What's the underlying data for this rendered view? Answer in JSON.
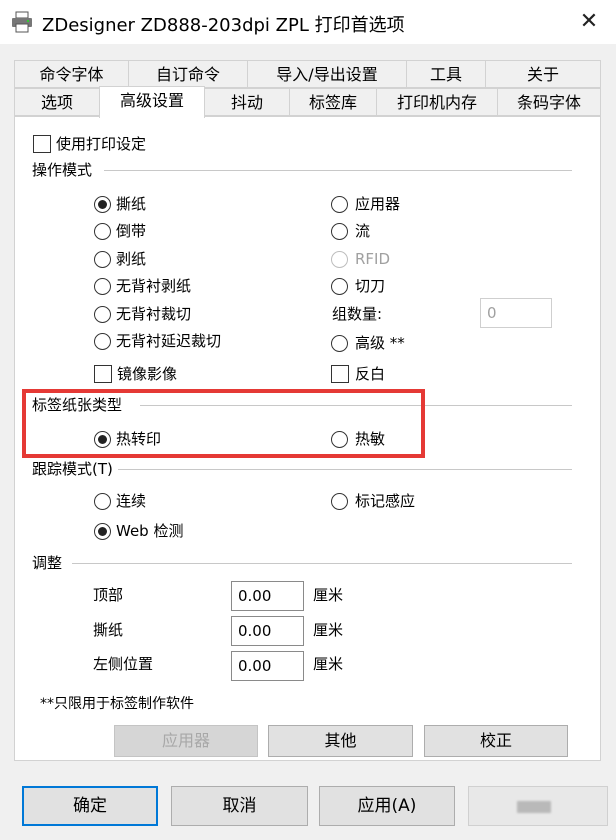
{
  "window": {
    "title": "ZDesigner ZD888-203dpi ZPL 打印首选项",
    "close_symbol": "✕"
  },
  "tabs_row1": [
    "命令字体",
    "自订命令",
    "导入/导出设置",
    "工具",
    "关于"
  ],
  "tabs_row2": [
    "选项",
    "高级设置",
    "抖动",
    "标签库",
    "打印机内存",
    "条码字体"
  ],
  "active_tab": "高级设置",
  "use_printer_settings": {
    "label": "使用打印设定",
    "checked": false
  },
  "operation_mode": {
    "title": "操作模式",
    "left": [
      {
        "label": "撕纸",
        "checked": true
      },
      {
        "label": "倒带",
        "checked": false
      },
      {
        "label": "剥纸",
        "checked": false
      },
      {
        "label": "无背衬剥纸",
        "checked": false
      },
      {
        "label": "无背衬裁切",
        "checked": false
      },
      {
        "label": "无背衬延迟裁切",
        "checked": false
      }
    ],
    "right": [
      {
        "label": "应用器",
        "checked": false
      },
      {
        "label": "流",
        "checked": false
      },
      {
        "label": "RFID",
        "checked": false,
        "disabled": true
      },
      {
        "label": "切刀",
        "checked": false
      }
    ],
    "group_count": {
      "label": "组数量:",
      "value": "0"
    },
    "advanced": {
      "label": "高级 **",
      "checked": false
    },
    "mirror": {
      "label": "镜像影像",
      "checked": false
    },
    "reverse": {
      "label": "反白",
      "checked": false
    }
  },
  "media_type": {
    "title": "标签纸张类型",
    "thermal_transfer": {
      "label": "热转印",
      "checked": true
    },
    "direct_thermal": {
      "label": "热敏",
      "checked": false
    }
  },
  "tracking_mode": {
    "title": "跟踪模式(T)",
    "continuous": {
      "label": "连续",
      "checked": false
    },
    "mark_sensing": {
      "label": "标记感应",
      "checked": false
    },
    "web_detect": {
      "label": "Web 检测",
      "checked": true
    }
  },
  "adjust": {
    "title": "调整",
    "rows": [
      {
        "label": "顶部",
        "value": "0.00",
        "unit": "厘米"
      },
      {
        "label": "撕纸",
        "value": "0.00",
        "unit": "厘米"
      },
      {
        "label": "左侧位置",
        "value": "0.00",
        "unit": "厘米"
      }
    ]
  },
  "footnote": "**只限用于标签制作软件",
  "panel_buttons": {
    "applicator": "应用器",
    "other": "其他",
    "calibrate": "校正"
  },
  "dialog_buttons": {
    "ok": "确定",
    "cancel": "取消",
    "apply": "应用(A)"
  },
  "colors": {
    "highlight_border": "#e53935",
    "default_button_border": "#0078d7"
  }
}
